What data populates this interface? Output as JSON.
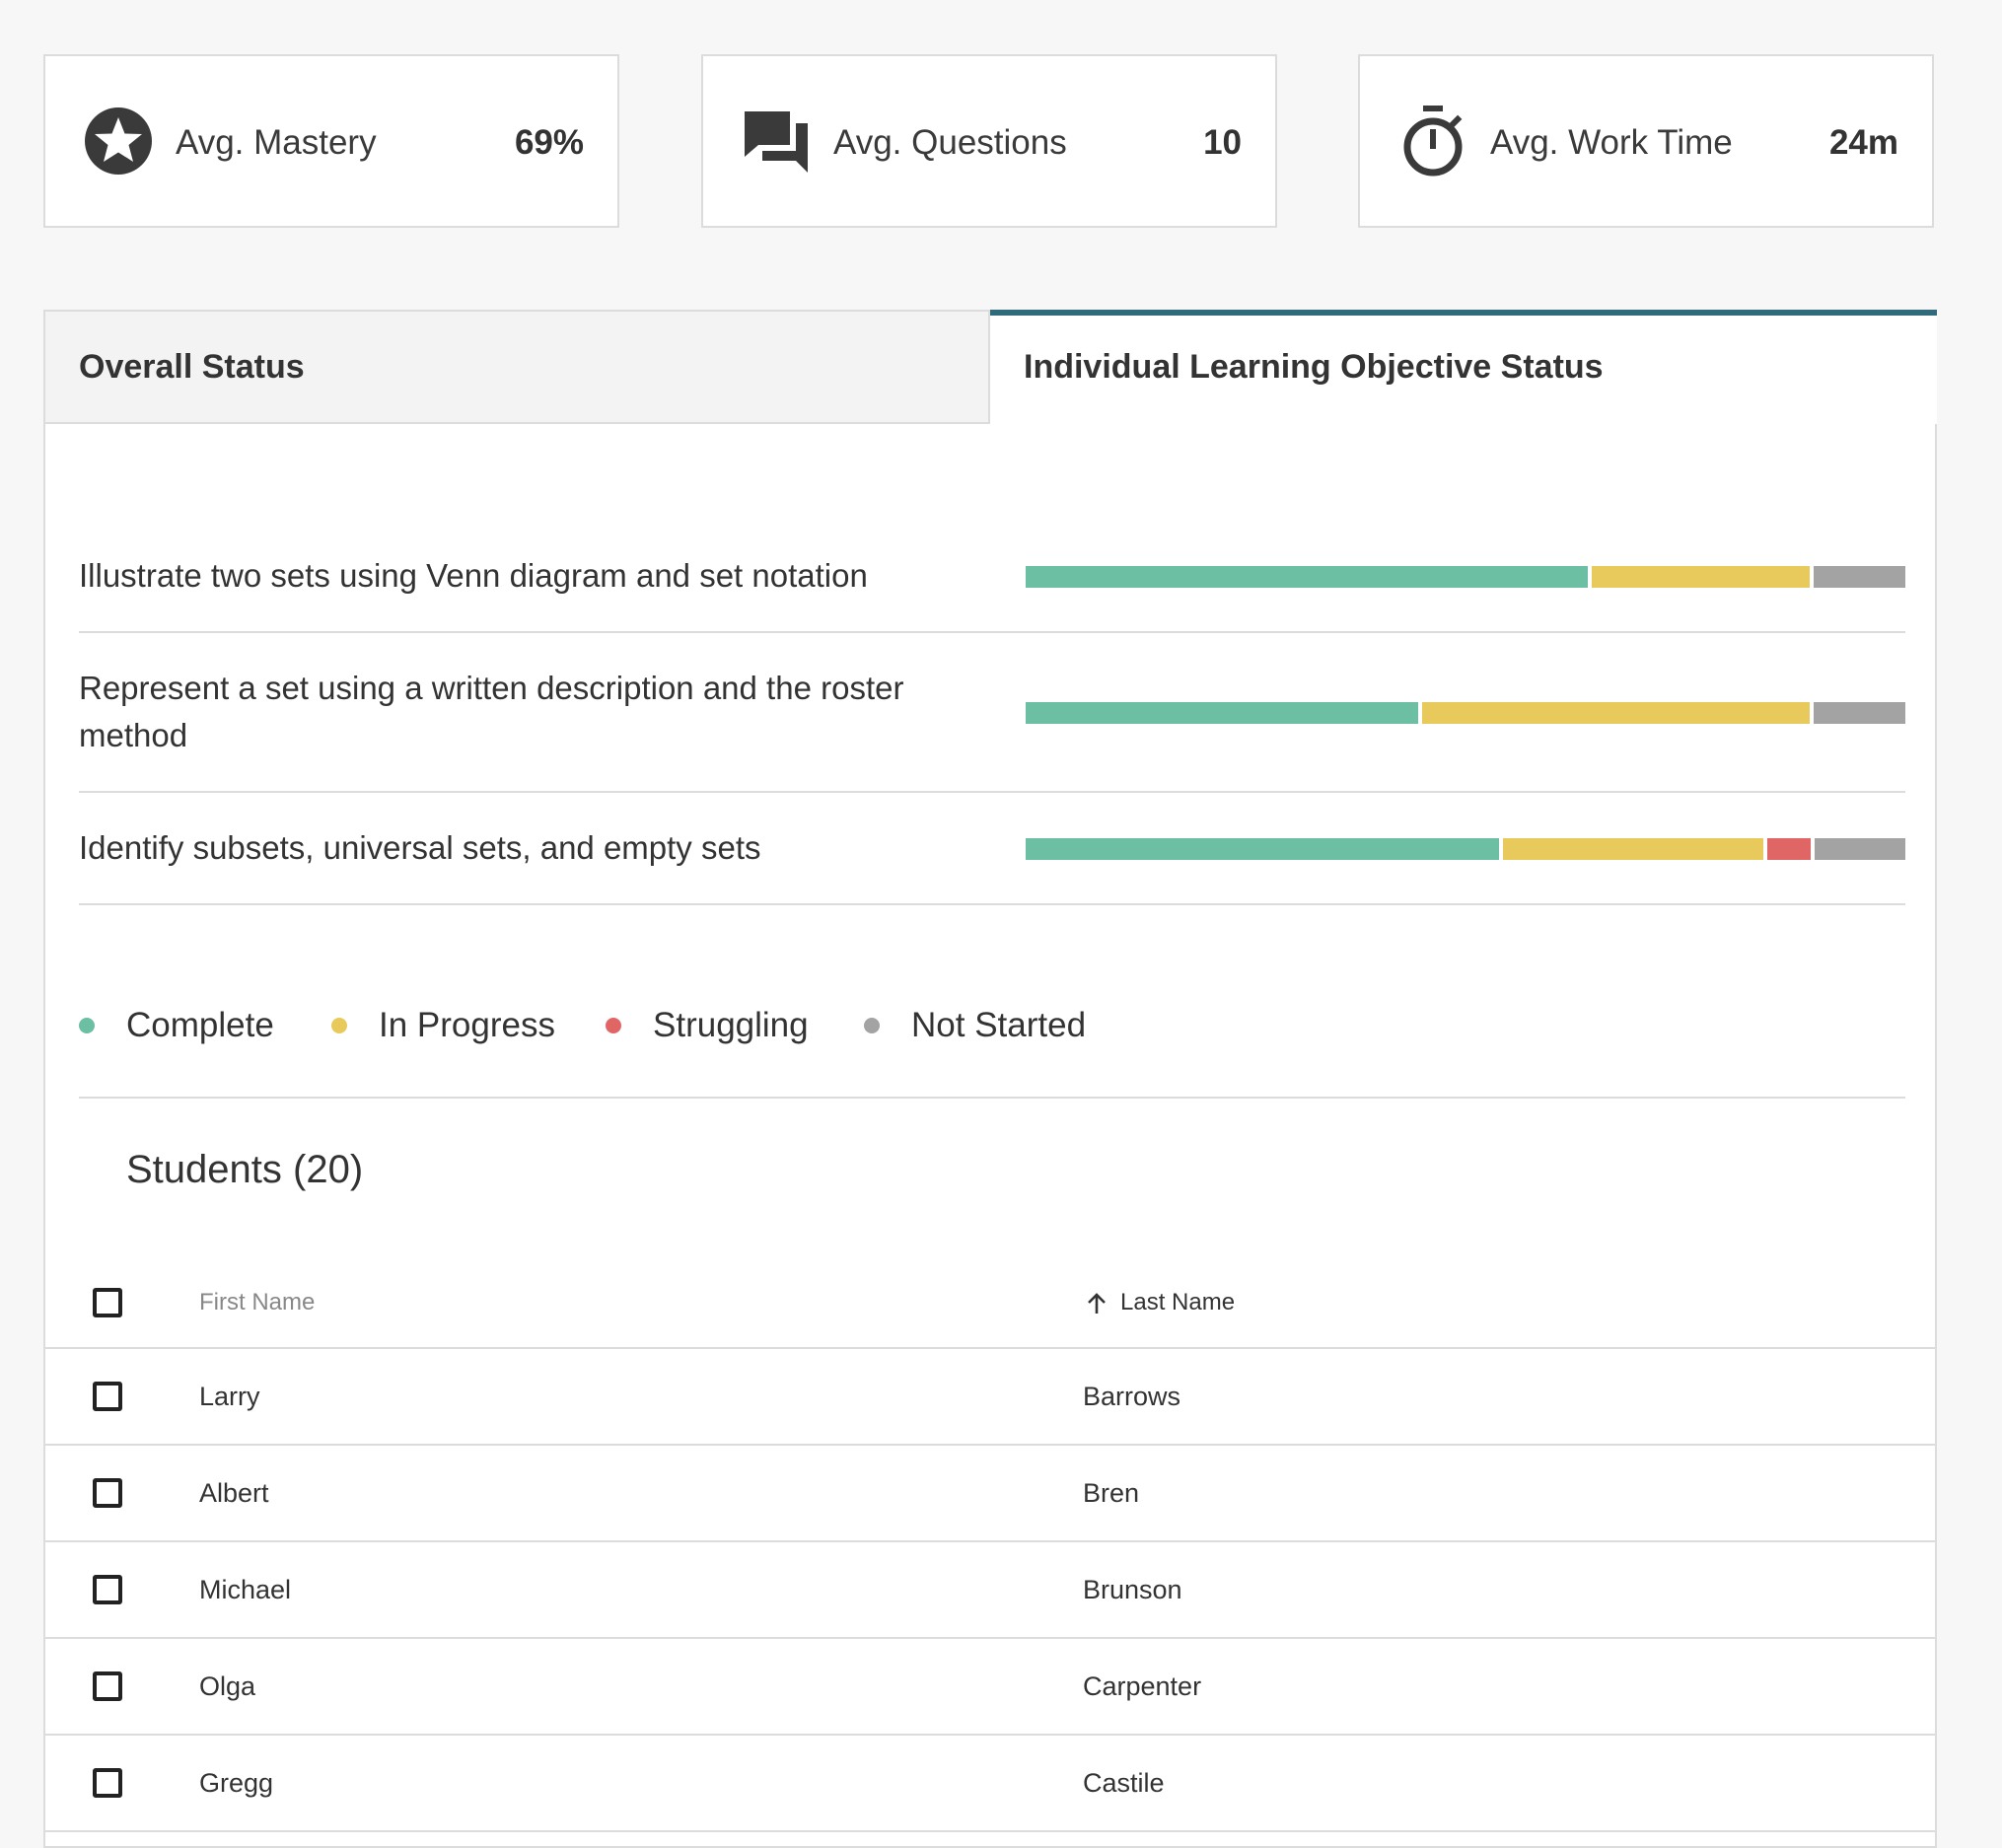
{
  "stats": [
    {
      "icon": "star-icon",
      "label": "Avg. Mastery",
      "value": "69%"
    },
    {
      "icon": "chat-icon",
      "label": "Avg. Questions",
      "value": "10"
    },
    {
      "icon": "stopwatch-icon",
      "label": "Avg. Work Time",
      "value": "24m"
    }
  ],
  "tabs": [
    {
      "label": "Overall Status",
      "active": false
    },
    {
      "label": "Individual Learning Objective Status",
      "active": true
    }
  ],
  "objectives": [
    {
      "text": "Illustrate two sets using Venn diagram and set notation",
      "complete": 0.645,
      "in_progress": 0.25,
      "struggling": 0.0,
      "not_started": 0.105
    },
    {
      "text": "Represent a set using a written description and the roster method",
      "complete": 0.45,
      "in_progress": 0.445,
      "struggling": 0.0,
      "not_started": 0.105
    },
    {
      "text": "Identify subsets, universal sets, and empty sets",
      "complete": 0.545,
      "in_progress": 0.3,
      "struggling": 0.05,
      "not_started": 0.105
    }
  ],
  "colors": {
    "complete": "#6cbfa3",
    "in_progress": "#e8c95b",
    "struggling": "#e06666",
    "not_started": "#a3a3a3",
    "tab_accent": "#2f6b7a"
  },
  "legend": [
    {
      "label": "Complete",
      "color": "#6cbfa3"
    },
    {
      "label": "In Progress",
      "color": "#e8c95b"
    },
    {
      "label": "Struggling",
      "color": "#e06666"
    },
    {
      "label": "Not Started",
      "color": "#a3a3a3"
    }
  ],
  "students": {
    "title": "Students (20)",
    "columns": {
      "first_name": "First Name",
      "last_name": "Last Name"
    },
    "sort_icon": "arrow-up-icon",
    "rows": [
      {
        "first": "Larry",
        "last": "Barrows"
      },
      {
        "first": "Albert",
        "last": "Bren"
      },
      {
        "first": "Michael",
        "last": "Brunson"
      },
      {
        "first": "Olga",
        "last": "Carpenter"
      },
      {
        "first": "Gregg",
        "last": "Castile"
      }
    ]
  }
}
